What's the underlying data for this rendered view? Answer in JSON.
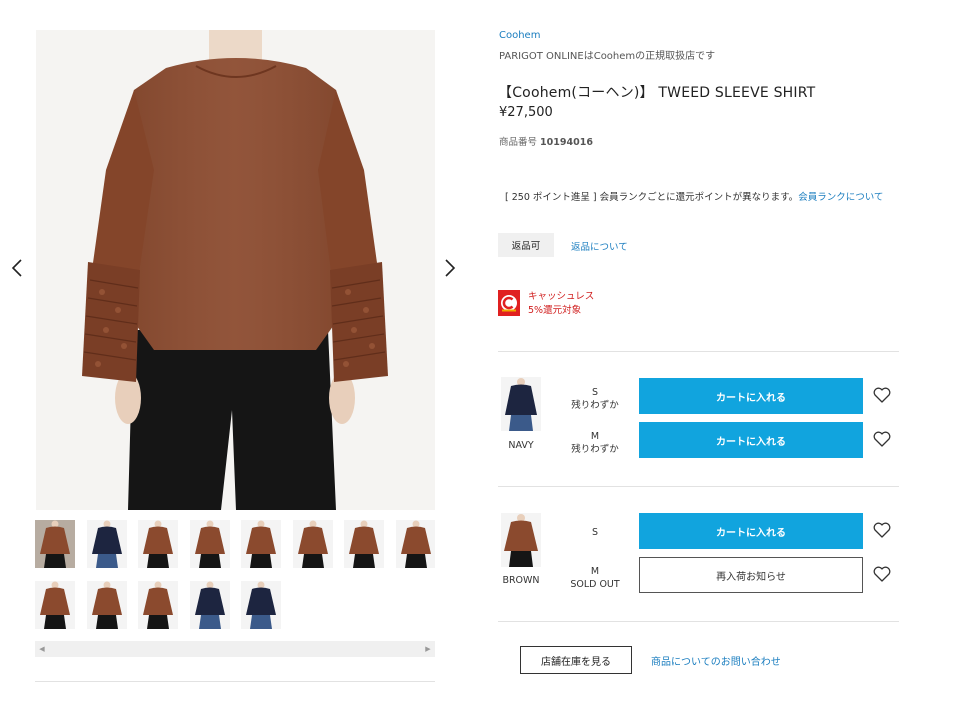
{
  "brand": {
    "name": "Coohem",
    "shop_note": "PARIGOT ONLINEはCoohemの正規取扱店です"
  },
  "product": {
    "title": "【Coohem(コーヘン)】 TWEED SLEEVE SHIRT",
    "price": "¥27,500",
    "number_label": "商品番号",
    "number_value": "10194016"
  },
  "points": {
    "text": "[ 250 ポイント進呈 ] 会員ランクごとに還元ポイントが異なります。",
    "link": "会員ランクについて"
  },
  "returns": {
    "badge": "返品可",
    "link": "返品について"
  },
  "cashless": {
    "text": "キャッシュレス5%還元対象"
  },
  "variants": [
    {
      "color": "NAVY",
      "sizes": [
        {
          "size": "S",
          "stock": "残りわずか",
          "button": "カートに入れる"
        },
        {
          "size": "M",
          "stock": "残りわずか",
          "button": "カートに入れる"
        }
      ]
    },
    {
      "color": "BROWN",
      "sizes": [
        {
          "size": "S",
          "stock": "",
          "button": "カートに入れる"
        },
        {
          "size": "M",
          "stock": "SOLD OUT",
          "button": "再入荷お知らせ"
        }
      ]
    }
  ],
  "actions": {
    "store_stock": "店舗在庫を見る",
    "inquiry": "商品についてのお問い合わせ"
  },
  "thumbnails": [
    {
      "color": "brown",
      "active": true
    },
    {
      "color": "navy"
    },
    {
      "color": "brown"
    },
    {
      "color": "brown"
    },
    {
      "color": "brown"
    },
    {
      "color": "brown"
    },
    {
      "color": "brown"
    },
    {
      "color": "brown"
    },
    {
      "color": "brown"
    },
    {
      "color": "brown"
    },
    {
      "color": "brown"
    },
    {
      "color": "navy"
    },
    {
      "color": "navy"
    }
  ],
  "colors": {
    "accent_blue": "#11a4de",
    "link_blue": "#1a7dbf",
    "cashless_red": "#e02020",
    "garment_brown": "#8b4a2e",
    "garment_navy": "#1d2540"
  },
  "icons": {
    "prev": "chevron-left-icon",
    "next": "chevron-right-icon",
    "favorite": "heart-outline-icon"
  }
}
